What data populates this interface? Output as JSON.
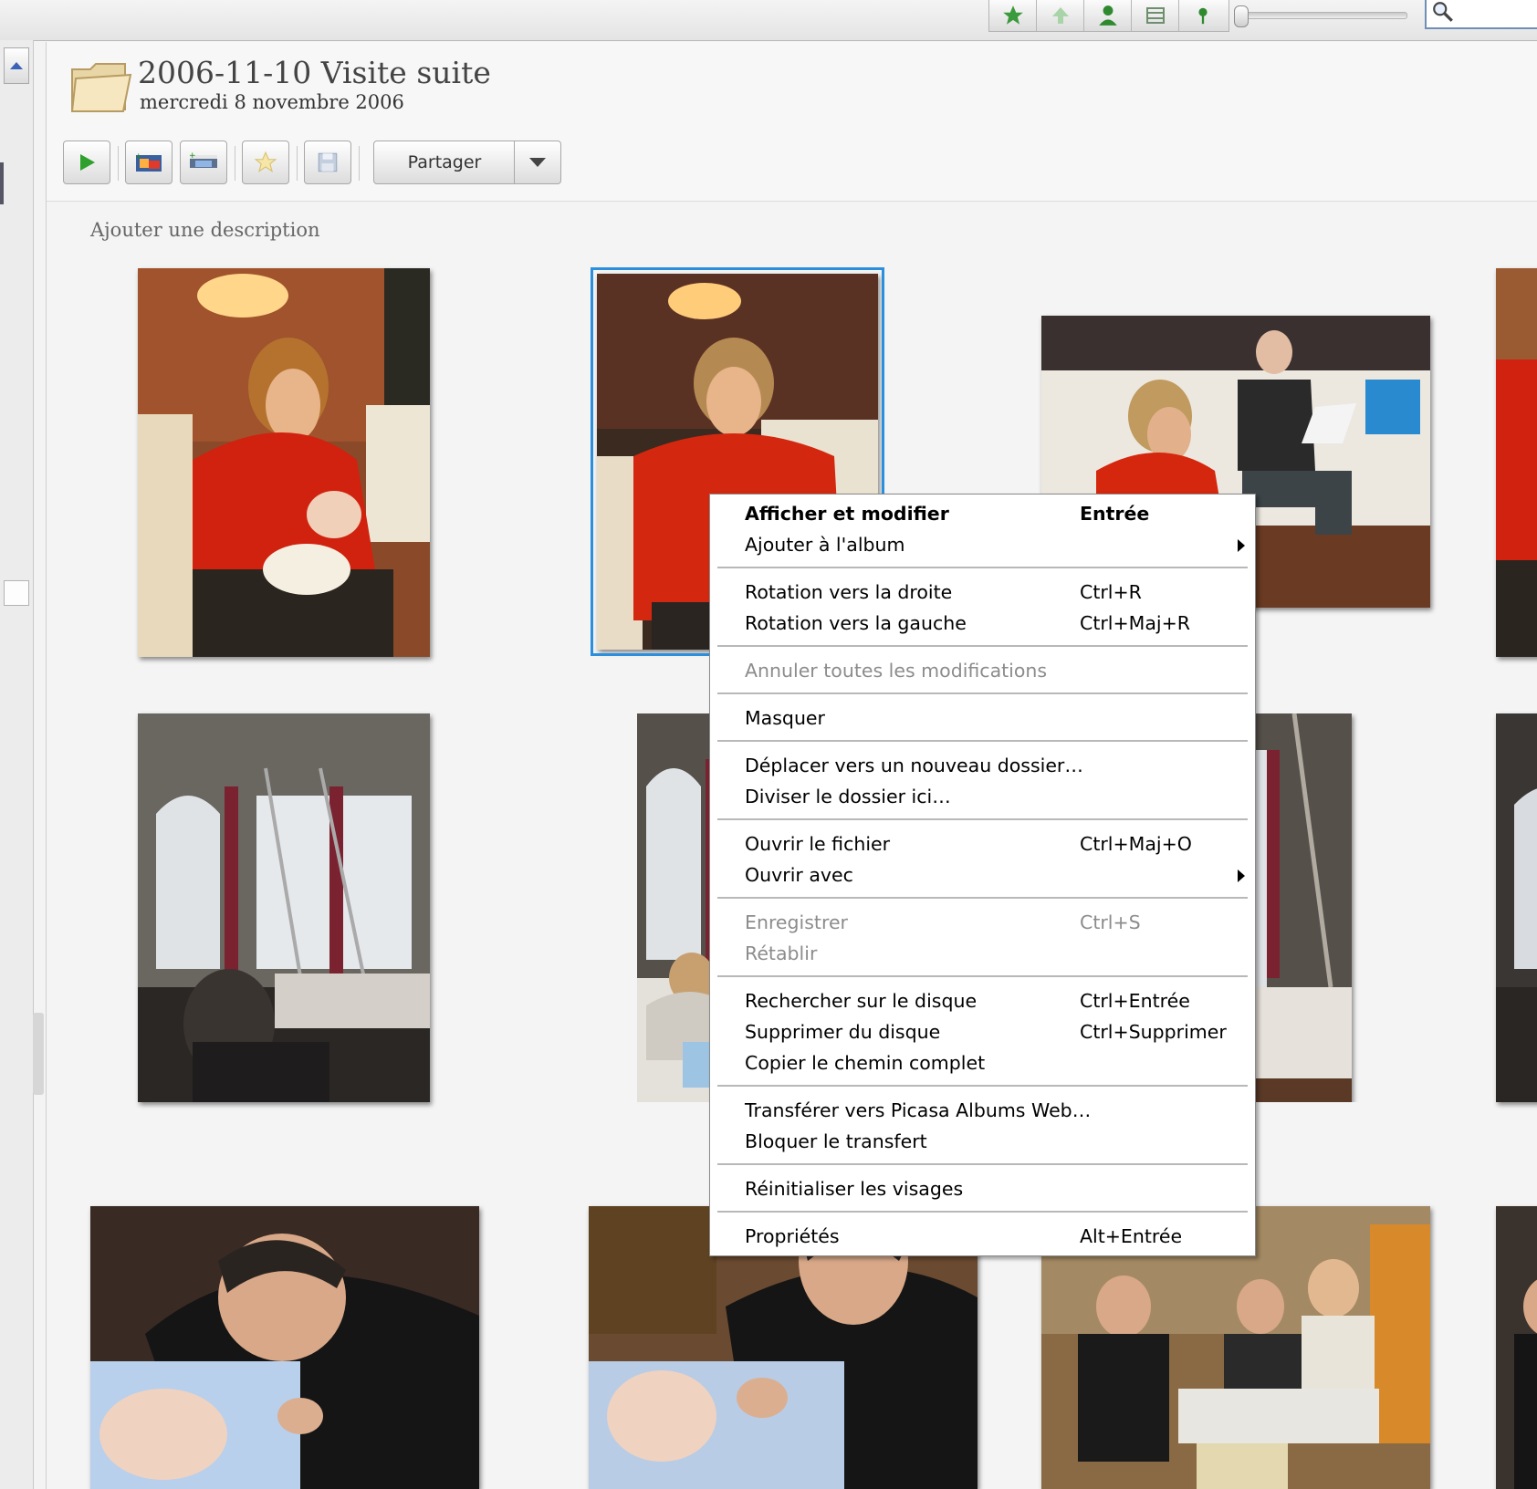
{
  "toolbar_top": {
    "filters": [
      {
        "name": "star-filter-icon",
        "color": "#3b9a3b"
      },
      {
        "name": "upload-filter-icon",
        "color": "#8fc48f"
      },
      {
        "name": "person-filter-icon",
        "color": "#2f8a2f"
      },
      {
        "name": "movie-filter-icon",
        "color": "#7a9a7a"
      },
      {
        "name": "geotag-filter-icon",
        "color": "#2f8a2f"
      }
    ],
    "search": {
      "value": ""
    }
  },
  "folder": {
    "title": "2006-11-10 Visite suite",
    "date": "mercredi 8 novembre 2006",
    "add_description": "Ajouter une description"
  },
  "actions": {
    "share_label": "Partager"
  },
  "photos": [
    "grandmother-holding-baby",
    "grandmother-holding-baby-selected",
    "grandparents-on-sofa",
    "edge-photo-red",
    "room-with-ladder",
    "grandmother-with-baby-in-room",
    "room-window-ladder",
    "edge-photo-room",
    "father-with-baby",
    "father-with-baby-close",
    "family-in-kitchen",
    "edge-photo-father"
  ],
  "context_menu": {
    "items": [
      {
        "label": "Afficher et modifier",
        "shortcut": "Entrée"
      },
      {
        "label": "Ajouter à l'album",
        "shortcut": ""
      },
      {
        "label": "Rotation vers la droite",
        "shortcut": "Ctrl+R"
      },
      {
        "label": "Rotation vers la gauche",
        "shortcut": "Ctrl+Maj+R"
      },
      {
        "label": "Annuler toutes les modifications",
        "shortcut": ""
      },
      {
        "label": "Masquer",
        "shortcut": ""
      },
      {
        "label": "Déplacer vers un nouveau dossier…",
        "shortcut": ""
      },
      {
        "label": "Diviser le dossier ici…",
        "shortcut": ""
      },
      {
        "label": "Ouvrir le fichier",
        "shortcut": "Ctrl+Maj+O"
      },
      {
        "label": "Ouvrir avec",
        "shortcut": ""
      },
      {
        "label": "Enregistrer",
        "shortcut": "Ctrl+S"
      },
      {
        "label": "Rétablir",
        "shortcut": ""
      },
      {
        "label": "Rechercher sur le disque",
        "shortcut": "Ctrl+Entrée"
      },
      {
        "label": "Supprimer du disque",
        "shortcut": "Ctrl+Supprimer"
      },
      {
        "label": "Copier le chemin complet",
        "shortcut": ""
      },
      {
        "label": "Transférer vers Picasa Albums Web…",
        "shortcut": ""
      },
      {
        "label": "Bloquer le transfert",
        "shortcut": ""
      },
      {
        "label": "Réinitialiser les visages",
        "shortcut": ""
      },
      {
        "label": "Propriétés",
        "shortcut": "Alt+Entrée"
      }
    ]
  },
  "colors": {
    "selection": "#2b8fde",
    "play_green": "#2ea02e"
  }
}
